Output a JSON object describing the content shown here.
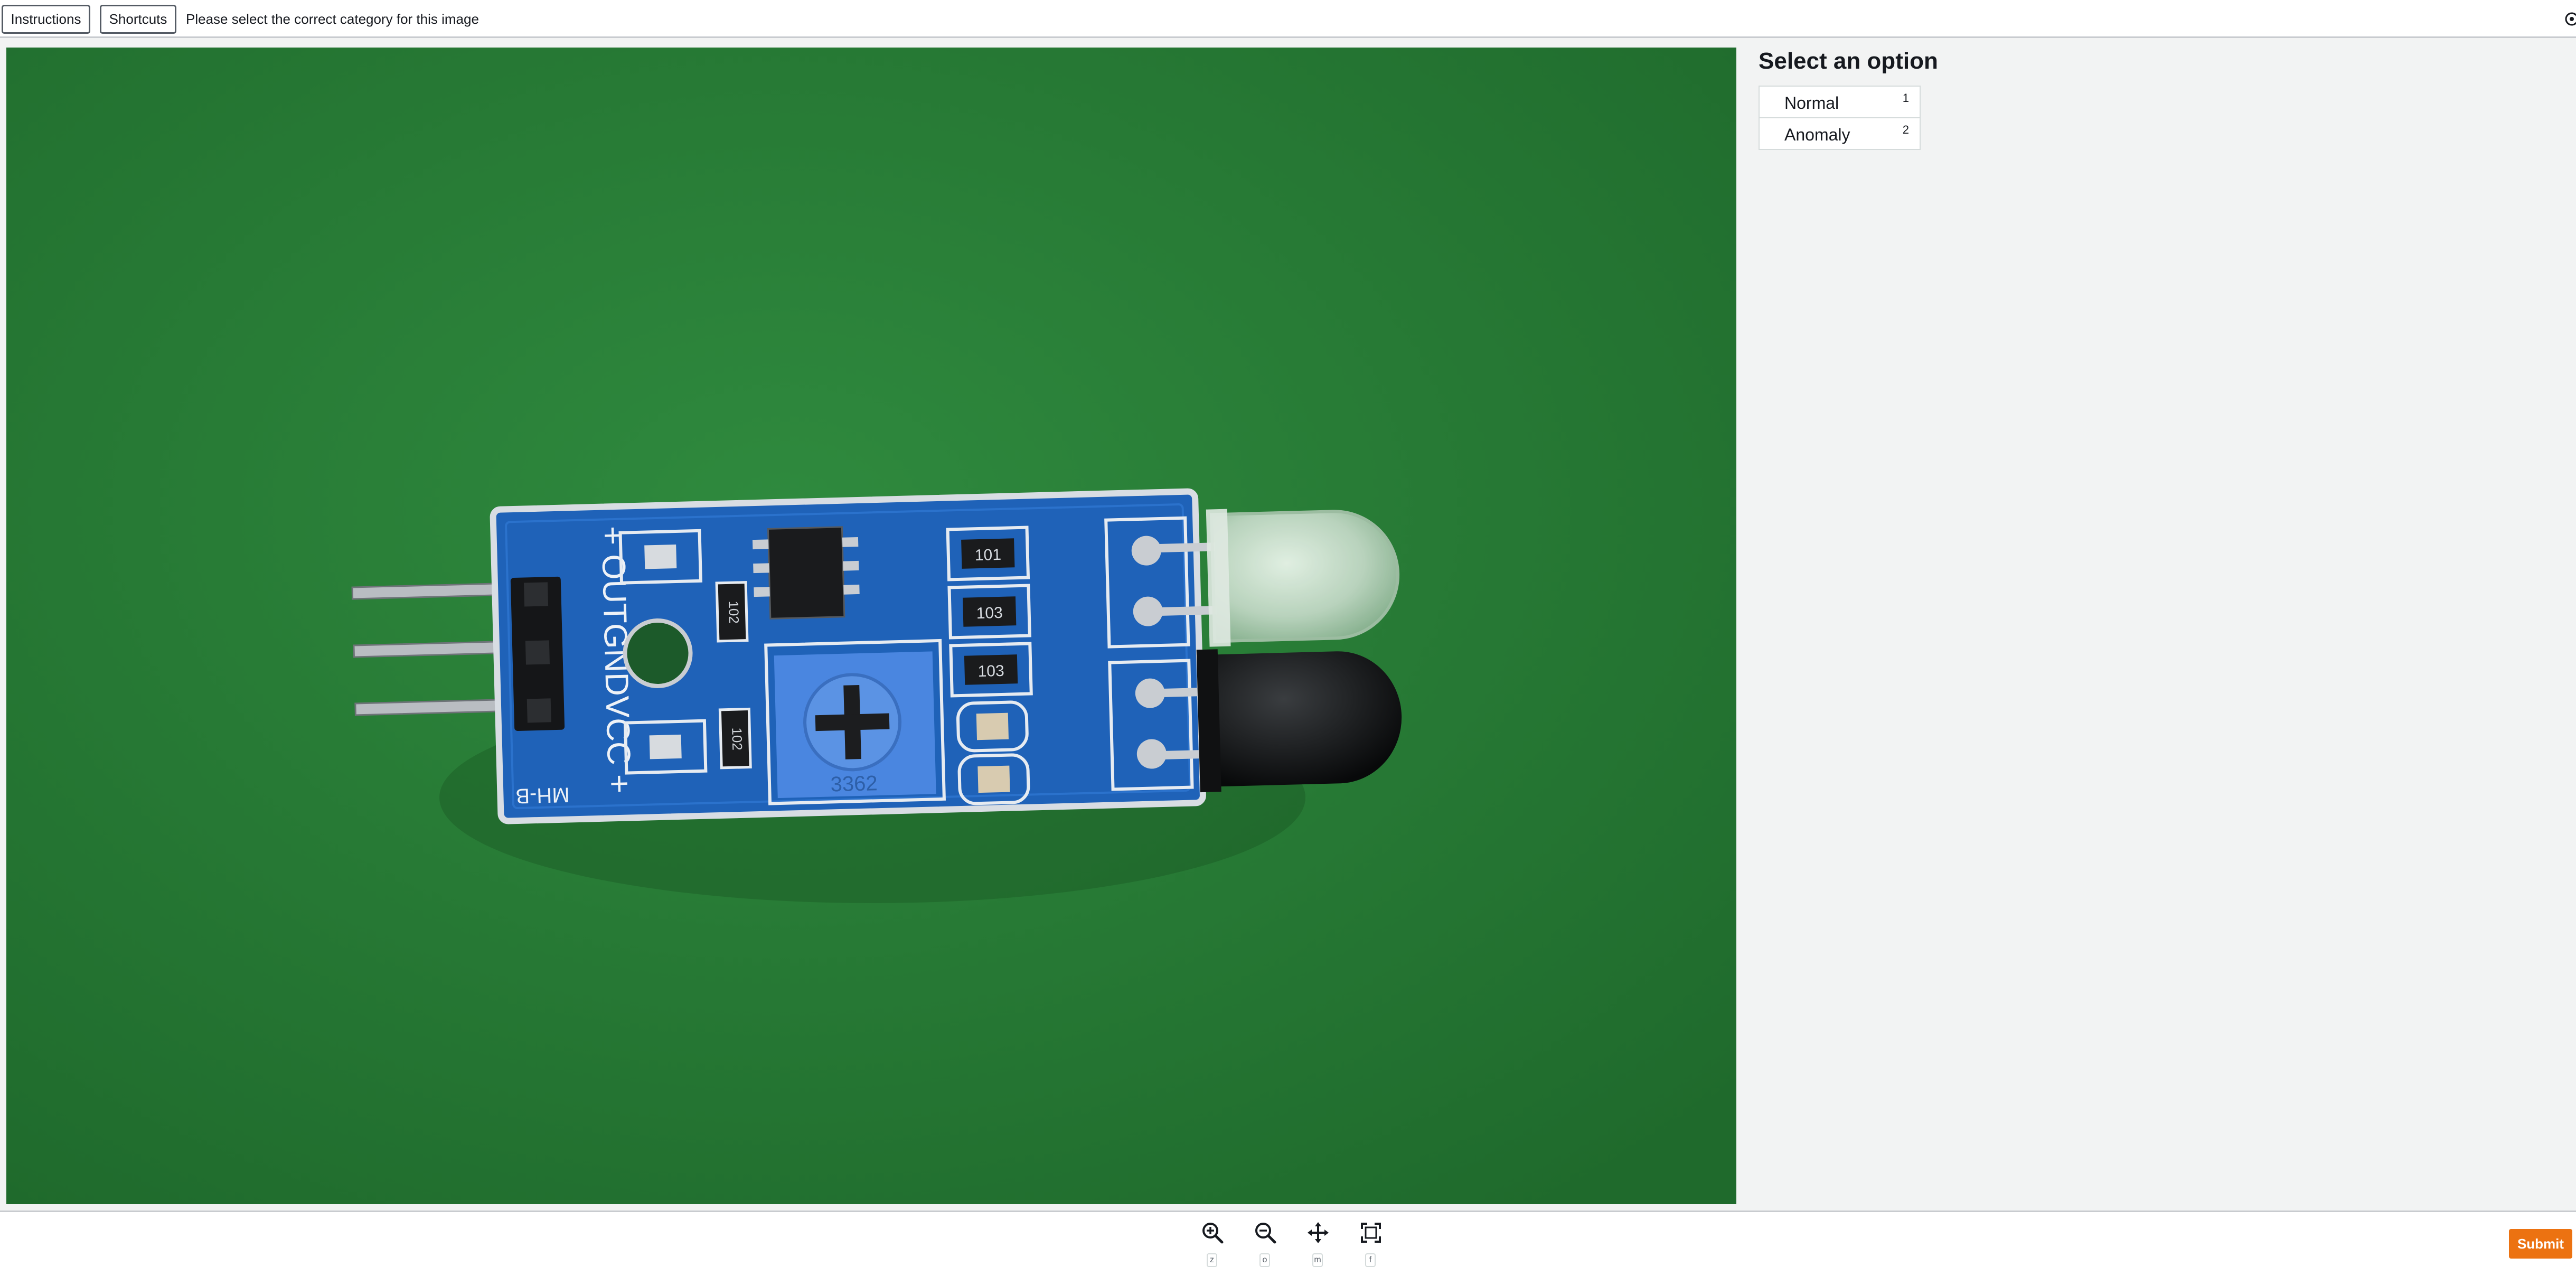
{
  "toolbar": {
    "instructions_label": "Instructions",
    "shortcuts_label": "Shortcuts",
    "task_text": "Please select the correct category for this image"
  },
  "panel": {
    "title": "Select an option",
    "options": [
      {
        "label": "Normal",
        "key": "1"
      },
      {
        "label": "Anomaly",
        "key": "2"
      }
    ]
  },
  "image": {
    "board_silk_top": "+ OUTGNDVCC +",
    "board_silk_bottom": "MH-B",
    "resistors": [
      "101",
      "103",
      "103"
    ],
    "small_resistors": [
      "102",
      "102"
    ],
    "potentiometer_text": "3362"
  },
  "tools": [
    {
      "name": "zoom-in",
      "icon": "zoom-in-icon",
      "key": "z"
    },
    {
      "name": "zoom-out",
      "icon": "zoom-out-icon",
      "key": "o"
    },
    {
      "name": "move",
      "icon": "move-icon",
      "key": "m"
    },
    {
      "name": "fit",
      "icon": "fit-to-screen-icon",
      "key": "f"
    }
  ],
  "submit_label": "Submit",
  "colors": {
    "accent": "#ec7211",
    "background_mat": "#2a7a36",
    "pcb": "#1f62b8",
    "panel_bg": "#f2f3f3"
  }
}
